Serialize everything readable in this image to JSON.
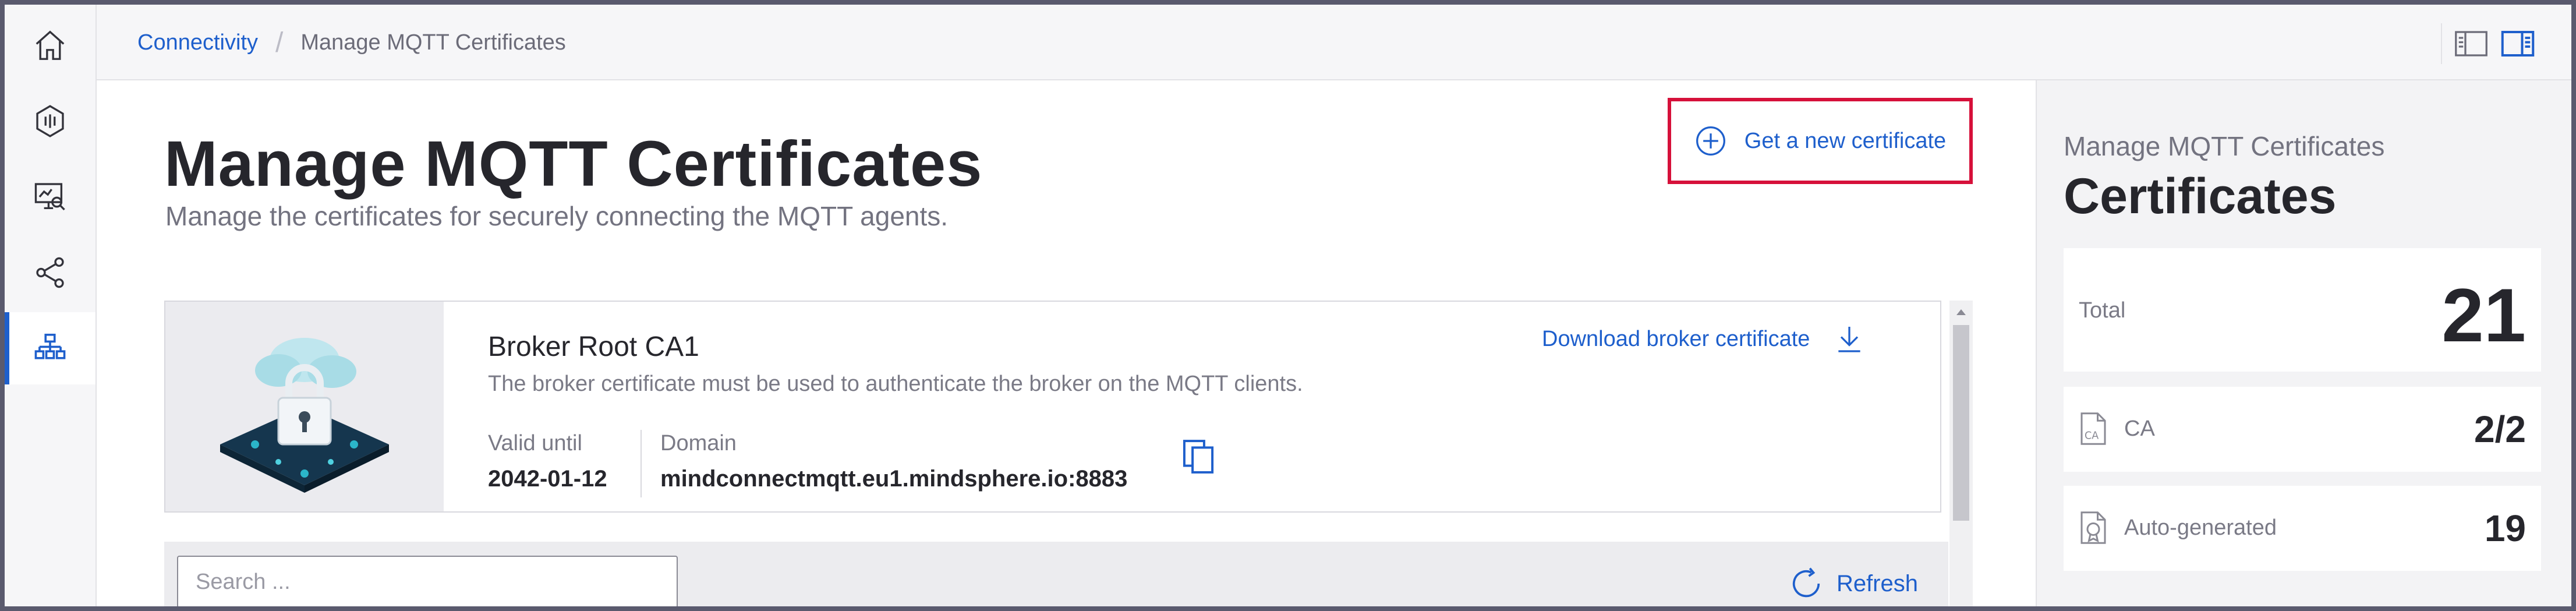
{
  "breadcrumb": {
    "parent": "Connectivity",
    "current": "Manage MQTT Certificates"
  },
  "nav": {
    "items": [
      {
        "icon": "home-icon"
      },
      {
        "icon": "sensor-icon"
      },
      {
        "icon": "monitor-search-icon"
      },
      {
        "icon": "share-icon"
      },
      {
        "icon": "network-icon",
        "active": true
      }
    ]
  },
  "header": {
    "title": "Manage MQTT Certificates",
    "subtitle": "Manage the certificates for securely connecting the MQTT agents.",
    "new_cert_label": "Get a new certificate"
  },
  "broker": {
    "title": "Broker Root CA1",
    "description": "The broker certificate must be used to authenticate the broker on the MQTT clients.",
    "download_label": "Download broker certificate",
    "valid_until_label": "Valid until",
    "valid_until": "2042-01-12",
    "domain_label": "Domain",
    "domain": "mindconnectmqtt.eu1.mindsphere.io:8883"
  },
  "search": {
    "placeholder": "Search ...",
    "value": ""
  },
  "refresh_label": "Refresh",
  "side": {
    "caption": "Manage MQTT Certificates",
    "title": "Certificates",
    "total_label": "Total",
    "total_value": "21",
    "ca_label": "CA",
    "ca_value": "2/2",
    "auto_label": "Auto-generated",
    "auto_value": "19"
  },
  "colors": {
    "accent": "#1e5fcc",
    "highlight_border": "#d6103a",
    "text_primary": "#26262c",
    "text_secondary": "#7a7a86"
  }
}
